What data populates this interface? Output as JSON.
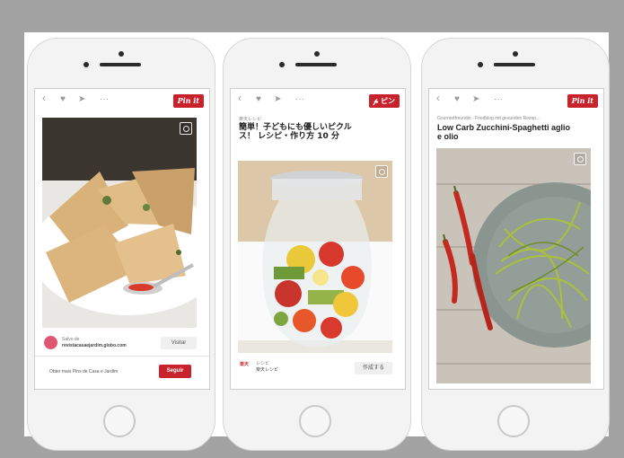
{
  "colors": {
    "accent": "#c8232c",
    "background": "#a3a3a3"
  },
  "toolbar": {
    "back_icon": "chevron-left-icon",
    "like_icon": "heart-icon",
    "send_icon": "send-icon",
    "more_label": "···"
  },
  "phone1": {
    "pin_label": "Pin it",
    "source_prefix": "Salvo de",
    "source_site": "revistacasaejardim.globo.com",
    "visit_label": "Visitar",
    "more_pins_text": "Obter mais Pins de Casa e Jardim",
    "follow_label": "Seguir"
  },
  "phone2": {
    "pin_label": "ピン",
    "source": "楽天レシピ",
    "title": "簡単！子どもにも優しいピクルス！ レシピ・作り方 10 分",
    "brand_logo": "楽天",
    "brand_line1": "レシピ",
    "brand_line2": "楽天レシピ",
    "action_label": "作成する"
  },
  "phone3": {
    "pin_label": "Pin it",
    "source": "Gourmetfreundin - Foodblog mit gesunden Rezep…",
    "title": "Low Carb Zucchini-Spaghetti aglio e olio"
  }
}
